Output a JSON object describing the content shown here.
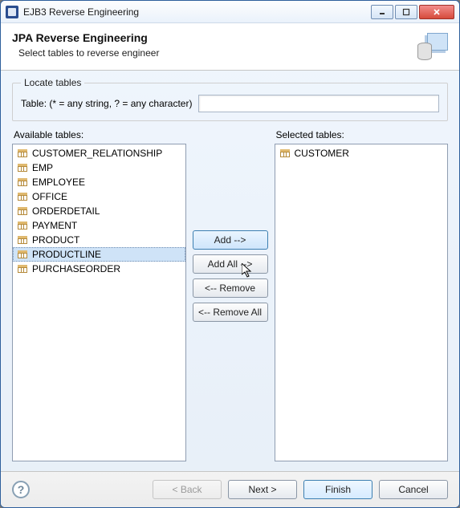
{
  "window": {
    "title": "EJB3 Reverse Engineering"
  },
  "header": {
    "title": "JPA Reverse Engineering",
    "subtitle": "Select tables to reverse engineer"
  },
  "locate": {
    "legend": "Locate tables",
    "label": "Table: (* = any string, ? = any character)",
    "value": ""
  },
  "lists": {
    "available_label": "Available tables:",
    "selected_label": "Selected tables:",
    "available": [
      "CUSTOMER_RELATIONSHIP",
      "EMP",
      "EMPLOYEE",
      "OFFICE",
      "ORDERDETAIL",
      "PAYMENT",
      "PRODUCT",
      "PRODUCTLINE",
      "PURCHASEORDER"
    ],
    "selected_index": 7,
    "selected": [
      "CUSTOMER"
    ]
  },
  "buttons": {
    "add": "Add -->",
    "add_all": "Add All -->",
    "remove": "<-- Remove",
    "remove_all": "<-- Remove All",
    "back": "< Back",
    "next": "Next >",
    "finish": "Finish",
    "cancel": "Cancel"
  }
}
